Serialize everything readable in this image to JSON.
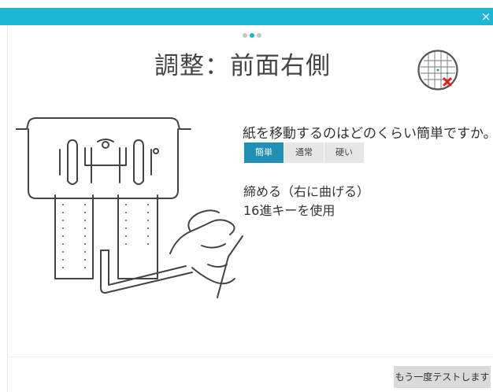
{
  "titlebar": {
    "close_glyph": "×",
    "close_icon": "close-icon"
  },
  "progress": {
    "total": 3,
    "current": 2
  },
  "page": {
    "title": "調整：前面右側"
  },
  "target_icon": "alignment-target-icon",
  "question": {
    "text": "紙を移動するのはどのくらい簡単ですか。"
  },
  "difficulty": {
    "options": [
      "簡単",
      "通常",
      "硬い"
    ],
    "selected": "簡単"
  },
  "instruction": {
    "line1": "締める（右に曲げる）",
    "line2": "16進キーを使用"
  },
  "footer": {
    "retest_label": "もう一度テストします"
  },
  "colors": {
    "accent": "#1fb6d5",
    "selected": "#1f8fb3",
    "marker": "#e02020",
    "grid": "#2a8f8f"
  }
}
